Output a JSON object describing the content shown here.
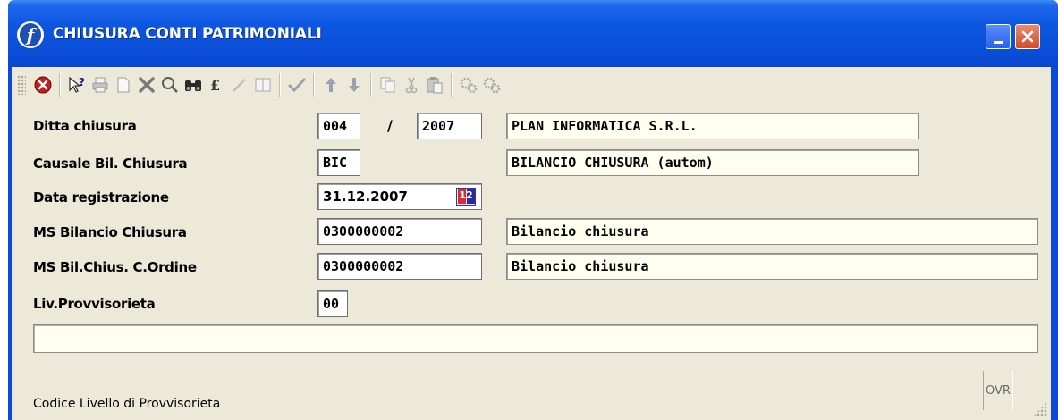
{
  "window": {
    "title": "CHIUSURA CONTI PATRIMONIALI",
    "app_icon": "f-logo-icon",
    "controls": [
      "minimize-icon",
      "close-icon"
    ]
  },
  "toolbar": {
    "tools": [
      "exit-icon",
      "help-icon",
      "print-icon",
      "new-icon",
      "delete-icon",
      "search-icon",
      "find-icon",
      "lookup-icon",
      "wand-icon",
      "columns-icon",
      "confirm-icon",
      "arrow-up-icon",
      "arrow-down-icon",
      "copy-icon",
      "cut-icon",
      "paste-icon",
      "gears-icon",
      "gears-alt-icon"
    ]
  },
  "form": {
    "ditta": {
      "label": "Ditta chiusura",
      "code": "004",
      "separator": "/",
      "year": "2007",
      "desc": "PLAN INFORMATICA S.R.L."
    },
    "causale": {
      "label": "Causale Bil. Chiusura",
      "code": "BIC",
      "desc": "BILANCIO CHIUSURA (autom)"
    },
    "data": {
      "label": "Data registrazione",
      "value": "31.12.2007",
      "icon": "calendar-icon"
    },
    "ms_bilancio": {
      "label": "MS Bilancio Chiusura",
      "code": "0300000002",
      "desc": "Bilancio chiusura"
    },
    "ms_ordine": {
      "label": "MS Bil.Chius. C.Ordine",
      "code": "0300000002",
      "desc": "Bilancio chiusura"
    },
    "livello": {
      "label": "Liv.Provvisorieta",
      "value": "00"
    }
  },
  "status": {
    "message": "",
    "hint": "Codice Livello di Provvisorieta",
    "mode": "OVR"
  },
  "colors": {
    "title_bar": "#0a4fd8",
    "client_bg": "#ece9d8",
    "close_button": "#d44a2a"
  }
}
